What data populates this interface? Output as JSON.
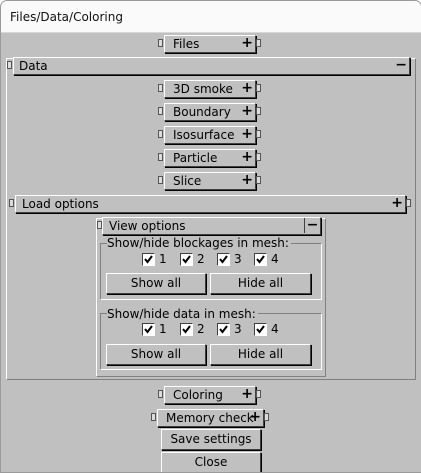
{
  "window": {
    "title": "Files/Data/Coloring"
  },
  "rollouts": {
    "files": {
      "label": "Files",
      "sign": "+"
    },
    "data": {
      "label": "Data",
      "sign": "−"
    },
    "smoke3d": {
      "label": "3D smoke",
      "sign": "+"
    },
    "boundary": {
      "label": "Boundary",
      "sign": "+"
    },
    "isosurface": {
      "label": "Isosurface",
      "sign": "+"
    },
    "particle": {
      "label": "Particle",
      "sign": "+"
    },
    "slice": {
      "label": "Slice",
      "sign": "+"
    },
    "load_options": {
      "label": "Load options",
      "sign": "+"
    },
    "view_options": {
      "label": "View options",
      "sign": "−"
    },
    "coloring": {
      "label": "Coloring",
      "sign": "+"
    },
    "memory_check": {
      "label": "Memory check",
      "sign": "+"
    }
  },
  "blockages": {
    "label": "Show/hide blockages in mesh:",
    "meshes": [
      {
        "label": "1",
        "checked": true
      },
      {
        "label": "2",
        "checked": true
      },
      {
        "label": "3",
        "checked": true
      },
      {
        "label": "4",
        "checked": true
      }
    ],
    "show_all": "Show all",
    "hide_all": "Hide all"
  },
  "data_meshes": {
    "label": "Show/hide data in mesh:",
    "meshes": [
      {
        "label": "1",
        "checked": true
      },
      {
        "label": "2",
        "checked": true
      },
      {
        "label": "3",
        "checked": true
      },
      {
        "label": "4",
        "checked": true
      }
    ],
    "show_all": "Show all",
    "hide_all": "Hide all"
  },
  "buttons": {
    "save_settings": "Save settings",
    "close": "Close"
  }
}
